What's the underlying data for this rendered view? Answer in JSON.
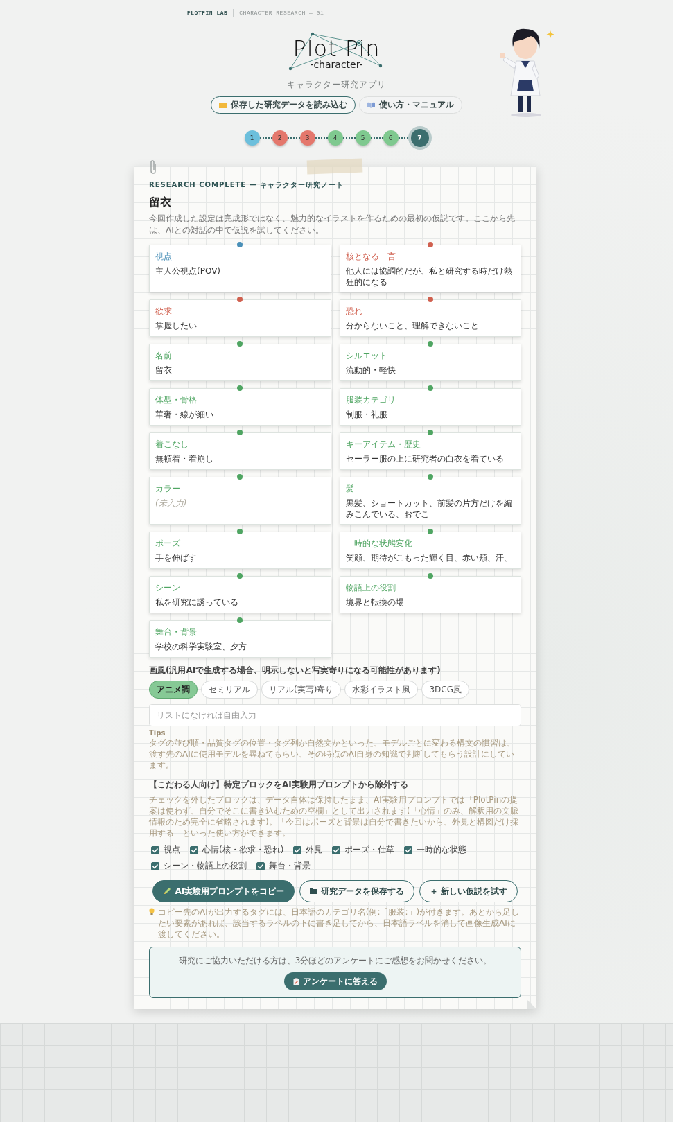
{
  "topbar": {
    "brand": "PLOTPIN LAB",
    "section": "CHARACTER RESEARCH — 01"
  },
  "logo": {
    "title": "Plot Pin",
    "subtitle": "-character-"
  },
  "tagline": "—キャラクター研究アプリ—",
  "header_buttons": [
    {
      "label": "保存した研究データを読み込む",
      "kind": "outline"
    },
    {
      "label": "使い方・マニュアル",
      "kind": "plain"
    }
  ],
  "steps": [
    {
      "label": "1",
      "color": "#6cbfdc",
      "selected": false
    },
    {
      "label": "2",
      "color": "#e4776c",
      "selected": false
    },
    {
      "label": "3",
      "color": "#e4776c",
      "selected": false
    },
    {
      "label": "4",
      "color": "#7fc98f",
      "selected": false
    },
    {
      "label": "5",
      "color": "#7fc98f",
      "selected": false
    },
    {
      "label": "6",
      "color": "#7fc98f",
      "selected": false
    },
    {
      "label": "7",
      "color": "#3b6e6e",
      "selected": true
    }
  ],
  "note": {
    "kicker": "RESEARCH COMPLETE — キャラクター研究ノート",
    "name": "留衣",
    "description": "今回作成した設定は完成形ではなく、魅力的なイラストを作るための最初の仮説です。ここから先は、AIとの対話の中で仮説を試してください。"
  },
  "cards": [
    {
      "label": "視点",
      "value": "主人公視点(POV)",
      "color": "#4a90b8",
      "empty": false
    },
    {
      "label": "核となる一言",
      "value": "他人には協調的だが、私と研究する時だけ熱狂的になる",
      "color": "#d0604f",
      "empty": false
    },
    {
      "label": "欲求",
      "value": "掌握したい",
      "color": "#d0604f",
      "empty": false
    },
    {
      "label": "恐れ",
      "value": "分からないこと、理解できないこと",
      "color": "#d0604f",
      "empty": false
    },
    {
      "label": "名前",
      "value": "留衣",
      "color": "#4fa562",
      "empty": false
    },
    {
      "label": "シルエット",
      "value": "流動的・軽快",
      "color": "#4fa562",
      "empty": false
    },
    {
      "label": "体型・骨格",
      "value": "華奢・線が細い",
      "color": "#4fa562",
      "empty": false
    },
    {
      "label": "服装カテゴリ",
      "value": "制服・礼服",
      "color": "#4fa562",
      "empty": false
    },
    {
      "label": "着こなし",
      "value": "無頓着・着崩し",
      "color": "#4fa562",
      "empty": false
    },
    {
      "label": "キーアイテム・歴史",
      "value": "セーラー服の上に研究者の白衣を着ている",
      "color": "#4fa562",
      "empty": false
    },
    {
      "label": "カラー",
      "value": "(未入力)",
      "color": "#4fa562",
      "empty": true
    },
    {
      "label": "髪",
      "value": "黒髪、ショートカット、前髪の片方だけを編みこんでいる、おでこ",
      "color": "#4fa562",
      "empty": false
    },
    {
      "label": "ポーズ",
      "value": "手を伸ばす",
      "color": "#4fa562",
      "empty": false
    },
    {
      "label": "一時的な状態変化",
      "value": "笑顔、期待がこもった輝く目、赤い頬、汗、",
      "color": "#4fa562",
      "empty": false
    },
    {
      "label": "シーン",
      "value": "私を研究に誘っている",
      "color": "#4fa562",
      "empty": false
    },
    {
      "label": "物語上の役割",
      "value": "境界と転換の場",
      "color": "#4fa562",
      "empty": false
    },
    {
      "label": "舞台・背景",
      "value": "学校の科学実験室、夕方",
      "color": "#4fa562",
      "empty": false
    }
  ],
  "style": {
    "heading": "画風(汎用AIで生成する場合、明示しないと写実寄りになる可能性があります)",
    "options": [
      {
        "label": "アニメ調",
        "selected": true
      },
      {
        "label": "セミリアル",
        "selected": false
      },
      {
        "label": "リアル(実写)寄り",
        "selected": false
      },
      {
        "label": "水彩イラスト風",
        "selected": false
      },
      {
        "label": "3DCG風",
        "selected": false
      }
    ],
    "input": {
      "placeholder": "リストになければ自由入力"
    },
    "tips_label": "Tips",
    "tips": "タグの並び順・品質タグの位置・タグ列か自然文かといった、モデルごとに変わる構文の慣習は、渡す先のAIに使用モデルを尋ねてもらい、その時点のAI自身の知識で判断してもらう設計にしています。"
  },
  "exclusion": {
    "heading": "【こだわる人向け】特定ブロックをAI実験用プロンプトから除外する",
    "description": "チェックを外したブロックは、データ自体は保持したまま、AI実験用プロンプトでは「PlotPinの提案は使わず、自分でそこに書き込むための空欄」として出力されます(「心情」のみ、解釈用の文脈情報のため完全に省略されます)。「今回はポーズと背景は自分で書きたいから、外見と構図だけ採用する」といった使い方ができます。",
    "blocks": [
      {
        "label": "視点",
        "checked": true
      },
      {
        "label": "心情(核・欲求・恐れ)",
        "checked": true
      },
      {
        "label": "外見",
        "checked": true
      },
      {
        "label": "ポーズ・仕草",
        "checked": true
      },
      {
        "label": "一時的な状態",
        "checked": true
      },
      {
        "label": "シーン・物語上の役割",
        "checked": true
      },
      {
        "label": "舞台・背景",
        "checked": true
      }
    ]
  },
  "actions": [
    {
      "label": "AI実験用プロンプトをコピー",
      "kind": "primary"
    },
    {
      "label": "研究データを保存する",
      "kind": "outline"
    },
    {
      "label": "＋ 新しい仮説を試す",
      "kind": "outline"
    }
  ],
  "copy_note": "コピー先のAIが出力するタグには、日本語のカテゴリ名(例:「服装:」)が付きます。あとから足したい要素があれば、該当するラベルの下に書き足してから、日本語ラベルを消して画像生成AIに渡してください。",
  "survey": {
    "text": "研究にご協力いただける方は、3分ほどのアンケートにご感想をお聞かせください。",
    "button": "アンケートに答える"
  }
}
